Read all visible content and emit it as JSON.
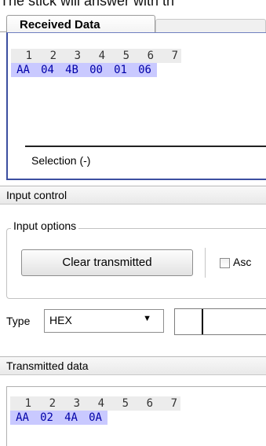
{
  "cut_header": "The stick will answer with th",
  "received": {
    "tab_label": "Received Data",
    "columns": [
      "1",
      "2",
      "3",
      "4",
      "5",
      "6",
      "7"
    ],
    "bytes": [
      "AA",
      "04",
      "4B",
      "00",
      "01",
      "06"
    ],
    "selection_label": "Selection (-)"
  },
  "input_control": {
    "section_title": "Input control",
    "group_title": "Input options",
    "clear_button": "Clear transmitted",
    "checkbox_label": "Asc",
    "checkbox_checked": false,
    "type_label": "Type",
    "type_value": "HEX",
    "hex_input_value": ""
  },
  "transmitted": {
    "section_title": "Transmitted data",
    "columns": [
      "1",
      "2",
      "3",
      "4",
      "5",
      "6",
      "7"
    ],
    "bytes": [
      "AA",
      "02",
      "4A",
      "0A"
    ]
  },
  "colors": {
    "byte_text": "#0000a8",
    "byte_highlight": "#c9c9ff",
    "panel_border": "#3c4fa0"
  }
}
